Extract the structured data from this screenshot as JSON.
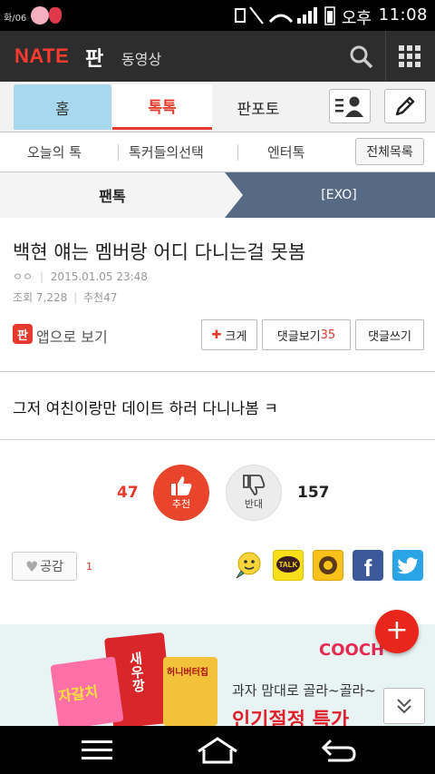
{
  "status_bar": {
    "date": "화/06",
    "ampm": "오후",
    "time": "11:08"
  },
  "header": {
    "logo": "NATE",
    "logo_suffix": "판",
    "video_link": "동영상",
    "accent_color": "#ff3a30",
    "background": "#2d2d2d"
  },
  "tabs": [
    {
      "label": "홈"
    },
    {
      "label": "톡톡"
    },
    {
      "label": "판포토"
    }
  ],
  "subnav": {
    "items": [
      "오늘의 톡",
      "톡커들의선택",
      "엔터톡"
    ],
    "all_button": "전체목록"
  },
  "breadcrumb": {
    "left": "팬톡",
    "right": "[EXO]"
  },
  "post": {
    "title": "백현 얘는 멤버랑 어디 다니는걸 못봄",
    "author": "ㅇㅇ",
    "datetime": "2015.01.05 23:48",
    "views_label": "조회",
    "views": "7,228",
    "recommend_label": "추천",
    "recommend_count": "47",
    "app_view": "앱으로 보기",
    "app_badge": "판",
    "enlarge_button": "크게",
    "comments_view": "댓글보기",
    "comments_count": "35",
    "comment_write": "댓글쓰기",
    "body": "그저 여친이랑만 데이트 하러 다니나봄 ㅋ"
  },
  "vote": {
    "up_count": "47",
    "up_label": "추천",
    "down_count": "157",
    "down_label": "반대"
  },
  "empathy": {
    "label": "공감",
    "count": "1"
  },
  "share_icons": [
    "emoticon-icon",
    "kakaotalk-icon",
    "kakaostory-icon",
    "facebook-icon",
    "twitter-icon"
  ],
  "ad": {
    "brand": "COOCH",
    "line1": "과자 맘대로 골라~골라~",
    "line2": "인기절정 특가",
    "snack1": "새우깡",
    "snack2": "자갈치",
    "snack3": "허니버터칩"
  }
}
